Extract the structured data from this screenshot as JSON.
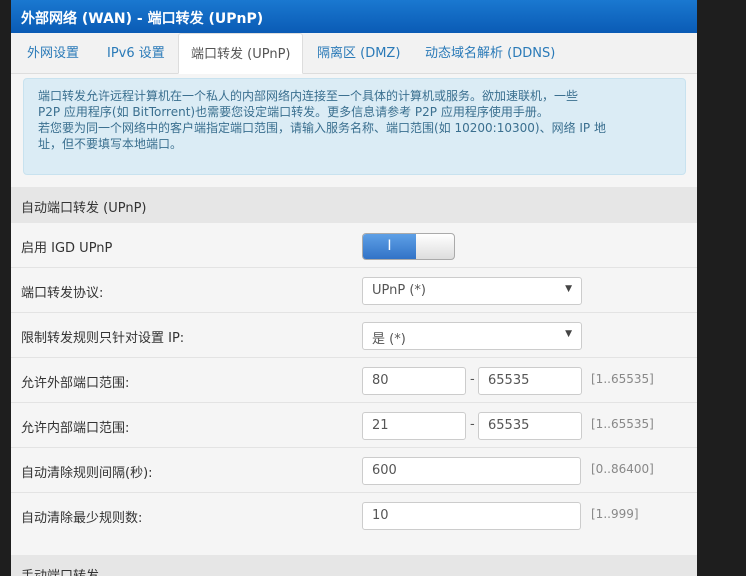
{
  "header": {
    "title": "外部网络 (WAN) - 端口转发 (UPnP)"
  },
  "tabs": [
    {
      "label": "外网设置"
    },
    {
      "label": "IPv6 设置"
    },
    {
      "label": "端口转发 (UPnP)",
      "active": true
    },
    {
      "label": "隔离区 (DMZ)"
    },
    {
      "label": "动态域名解析 (DDNS)"
    }
  ],
  "info": {
    "lines": [
      "端口转发允许远程计算机在一个私人的内部网络内连接至一个具体的计算机或服务。欲加速联机，一些",
      "P2P 应用程序(如 BitTorrent)也需要您设定端口转发。更多信息请参考 P2P 应用程序使用手册。",
      "若您要为同一个网络中的客户端指定端口范围，请输入服务名称、端口范围(如 10200:10300)、网络 IP 地",
      "址，但不要填写本地端口。"
    ]
  },
  "section1": {
    "title": "自动端口转发 (UPnP)"
  },
  "rows": {
    "igd": {
      "label": "启用 IGD UPnP",
      "toggle_on": true,
      "toggle_glyph": "I"
    },
    "protocol": {
      "label": "端口转发协议:",
      "value": "UPnP (*)"
    },
    "restrict": {
      "label": "限制转发规则只针对设置 IP:",
      "value": "是 (*)"
    },
    "ext": {
      "label": "允许外部端口范围:",
      "from": "80",
      "to": "65535",
      "hint": "[1..65535]"
    },
    "int": {
      "label": "允许内部端口范围:",
      "from": "21",
      "to": "65535",
      "hint": "[1..65535]"
    },
    "interval": {
      "label": "自动清除规则间隔(秒):",
      "value": "600",
      "hint": "[0..86400]"
    },
    "minrules": {
      "label": "自动清除最少规则数:",
      "value": "10",
      "hint": "[1..999]"
    }
  },
  "section2": {
    "title": "手动端口转发"
  },
  "dash": "-",
  "arrow": "▼"
}
